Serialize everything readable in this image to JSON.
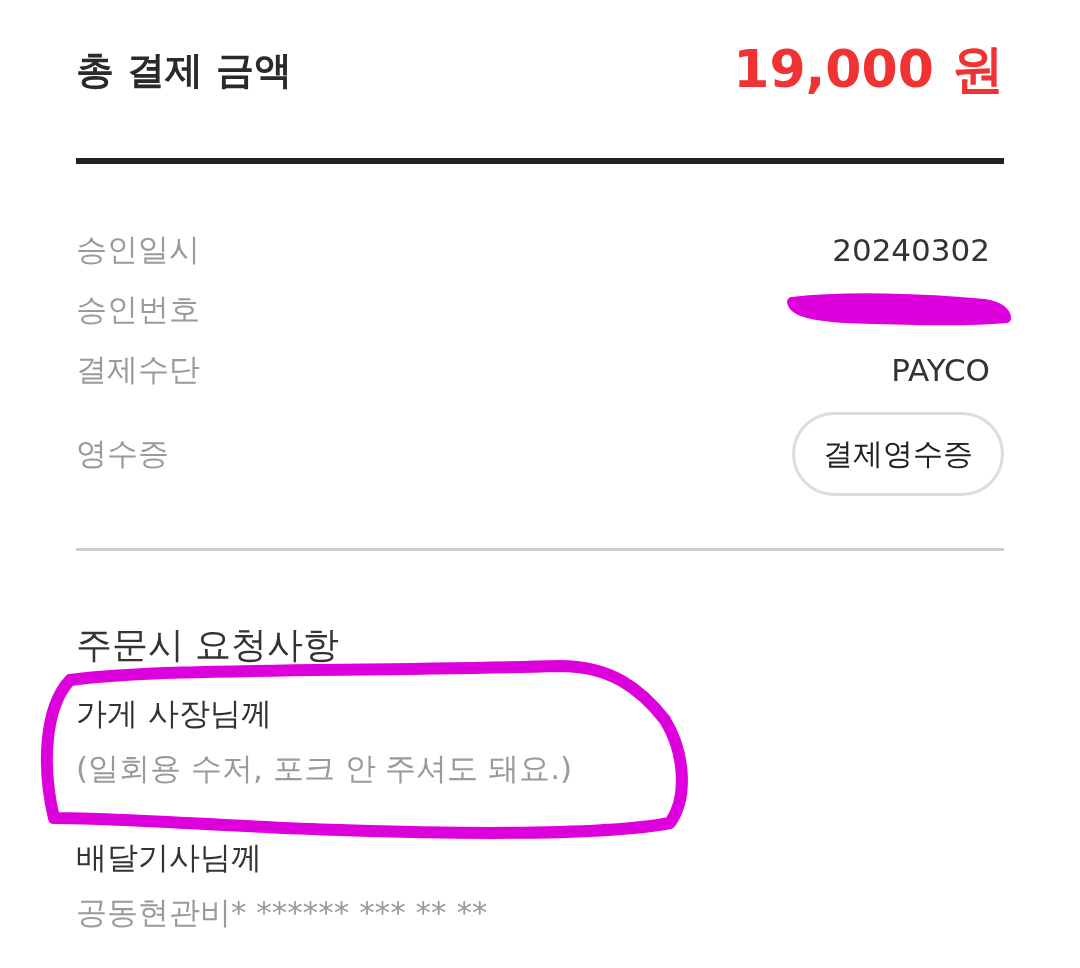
{
  "total": {
    "label": "총 결제 금액",
    "amount": "19,000 원"
  },
  "details": [
    {
      "label": "승인일시",
      "kind": "text",
      "value": "20240302"
    },
    {
      "label": "승인번호",
      "kind": "hidden"
    },
    {
      "label": "결제수단",
      "kind": "text",
      "value": "PAYCO"
    },
    {
      "label": "영수증",
      "kind": "button",
      "value": "결제영수증"
    }
  ],
  "requests": {
    "title": "주문시 요청사항",
    "items": [
      {
        "recipient": "가게 사장님께",
        "message": "(일회용 수저, 포크 안 주셔도 돼요.)",
        "circled": true
      },
      {
        "recipient": "배달기사님께",
        "message": "공동현관비* ****** *** ** **",
        "circled": false
      }
    ]
  }
}
